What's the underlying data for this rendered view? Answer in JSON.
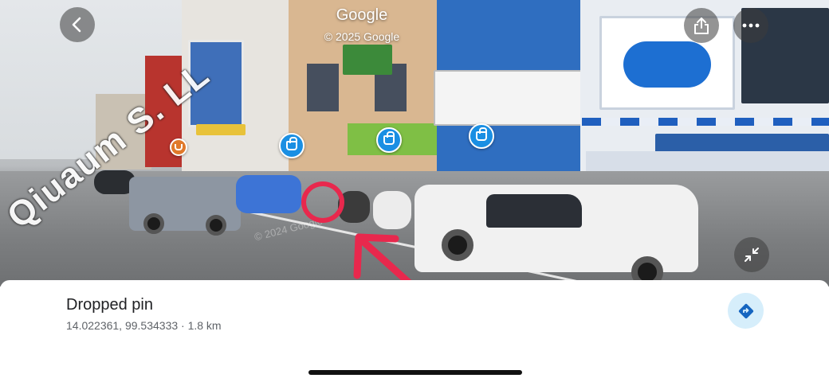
{
  "header": {
    "title": "Google",
    "subtitle": "© 2025 Google"
  },
  "streetview": {
    "road_text": "Qiuaum S. LL",
    "watermark": "© 2024 Google",
    "markers": [
      {
        "type": "shopping",
        "icon": "shopping-bag-icon"
      },
      {
        "type": "shopping",
        "icon": "shopping-bag-icon"
      },
      {
        "type": "shopping",
        "icon": "shopping-bag-icon"
      },
      {
        "type": "cafe",
        "icon": "coffee-cup-icon"
      }
    ],
    "annotation_color": "#e8284d"
  },
  "toolbar": {
    "back_icon": "chevron-left-icon",
    "share_icon": "share-icon",
    "more_icon": "more-horizontal-icon",
    "collapse_icon": "collapse-icon"
  },
  "place": {
    "name": "Dropped pin",
    "details": "14.022361, 99.534333 · 1.8 km",
    "directions_icon": "directions-icon"
  },
  "colors": {
    "accent": "#1a73e8",
    "directions_bg": "#d6eefb",
    "marker": "#1a8fe3"
  }
}
